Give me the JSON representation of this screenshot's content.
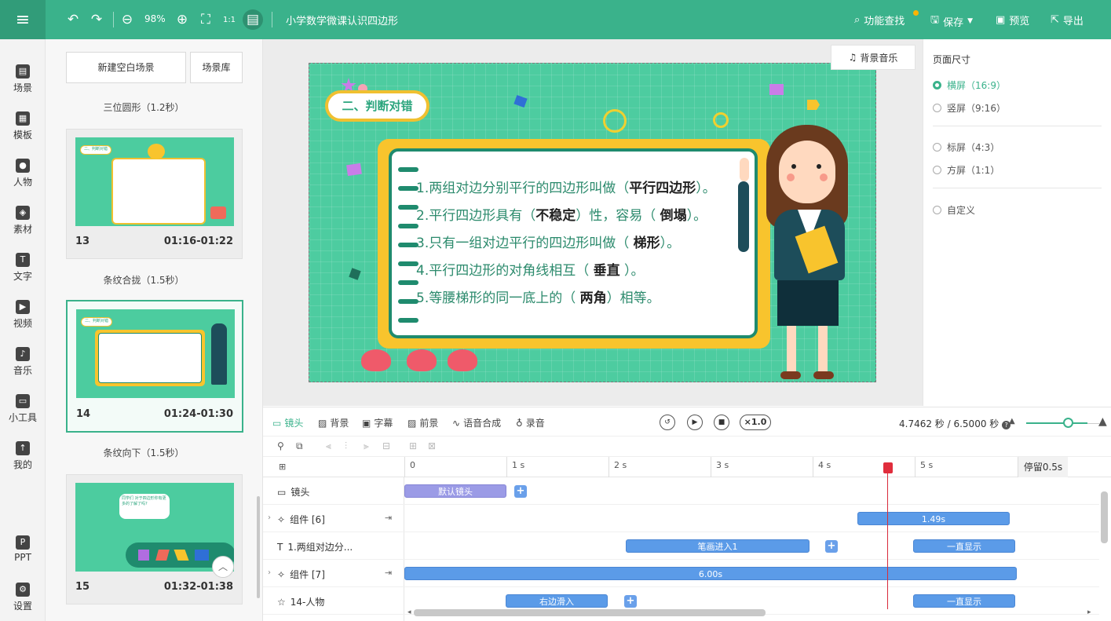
{
  "topbar": {
    "zoom": "98%",
    "title": "小学数学微课认识四边形",
    "find": "功能查找",
    "save": "保存",
    "preview": "预览",
    "export": "导出"
  },
  "nav": [
    {
      "label": "场景"
    },
    {
      "label": "模板"
    },
    {
      "label": "人物"
    },
    {
      "label": "素材"
    },
    {
      "label": "文字"
    },
    {
      "label": "视频"
    },
    {
      "label": "音乐"
    },
    {
      "label": "小工具"
    },
    {
      "label": "我的"
    },
    {
      "label": "PPT"
    },
    {
      "label": "设置"
    }
  ],
  "scenes": {
    "new_blank": "新建空白场景",
    "library": "场景库",
    "items": [
      {
        "transition": "三位圆形（1.2秒）",
        "num": "13",
        "time": "01:16-01:22",
        "mini_title": "二、判断对错"
      },
      {
        "transition": "条纹合拢（1.5秒）",
        "num": "14",
        "time": "01:24-01:30",
        "mini_title": "二、判断对错"
      },
      {
        "transition": "条纹向下（1.5秒）",
        "num": "15",
        "time": "01:32-01:38",
        "mini_bubble": "同学们 对于四边形你有更多的了解了吗?"
      }
    ]
  },
  "slide": {
    "title": "二、判断对错",
    "lines": [
      {
        "a": "1.两组对边分别平行的四边形叫做（",
        "b": "平行四边形",
        "c": "）。"
      },
      {
        "a": "2.平行四边形具有（",
        "b": "不稳定",
        "c": "）性，容易（ ",
        "b2": "倒塌",
        "c2": "）。"
      },
      {
        "a": "3.只有一组对边平行的四边形叫做（ ",
        "b": "梯形",
        "c": "）。"
      },
      {
        "a": "4.平行四边形的对角线相互（ ",
        "b": "垂直",
        "c": " ）。"
      },
      {
        "a": "5.等腰梯形的同一底上的（ ",
        "b": "两角",
        "c": "）相等。"
      }
    ]
  },
  "bgm": "背景音乐",
  "page_size": {
    "title": "页面尺寸",
    "options": [
      "横屏（16:9）",
      "竖屏（9:16）",
      "标屏（4:3）",
      "方屏（1:1）",
      "自定义"
    ],
    "selected": "横屏（16:9）"
  },
  "timeline": {
    "tabs": [
      "镜头",
      "背景",
      "字幕",
      "前景",
      "语音合成",
      "录音"
    ],
    "speed": "×1.0",
    "time_readout": "4.7462 秒 / 6.5000 秒",
    "ticks": [
      "0",
      "1 s",
      "2 s",
      "3 s",
      "4 s",
      "5 s"
    ],
    "stay": "停留0.5s",
    "rows": [
      {
        "label": "镜头",
        "clips": [
          {
            "text": "默认镜头"
          }
        ]
      },
      {
        "label": "组件 [6]",
        "clips": [
          {
            "text": "1.49s"
          }
        ]
      },
      {
        "label": "1.两组对边分...",
        "clips": [
          {
            "text": "笔画进入1"
          },
          {
            "text": "一直显示"
          }
        ]
      },
      {
        "label": "组件 [7]",
        "clips": [
          {
            "text": "6.00s"
          }
        ]
      },
      {
        "label": "14-人物",
        "clips": [
          {
            "text": "右边滑入"
          },
          {
            "text": "一直显示"
          }
        ]
      }
    ]
  },
  "colors": {
    "brand": "#3ab28b",
    "slide_bg": "#4dcca0",
    "board": "#f8c42d",
    "clip": "#5b9be8",
    "playhead": "#d92b3a"
  }
}
